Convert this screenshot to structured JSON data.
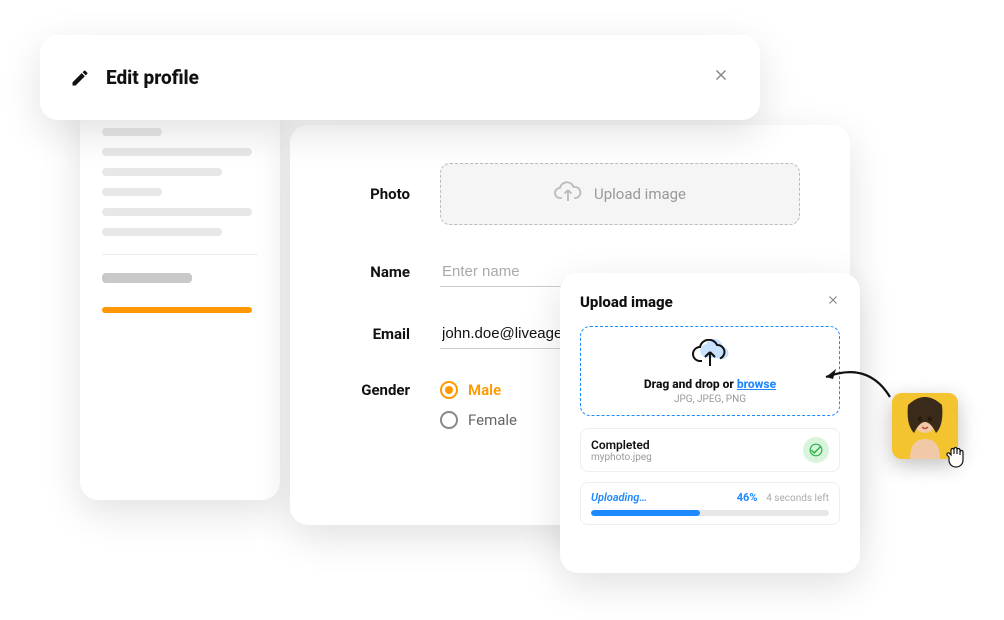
{
  "header": {
    "title": "Edit profile"
  },
  "form": {
    "photo_label": "Photo",
    "upload_zone_text": "Upload image",
    "name_label": "Name",
    "name_placeholder": "Enter name",
    "email_label": "Email",
    "email_value": "john.doe@liveagent.com",
    "gender_label": "Gender",
    "gender_options": {
      "male": "Male",
      "female": "Female"
    },
    "gender_selected": "male"
  },
  "upload_modal": {
    "title": "Upload image",
    "dropzone_prefix": "Drag and drop or ",
    "dropzone_link": "browse",
    "dropzone_formats": "JPG, JPEG, PNG",
    "completed": {
      "status": "Completed",
      "filename": "myphoto.jpeg"
    },
    "progress": {
      "status": "Uploading…",
      "percent": "46%",
      "percent_value": 46,
      "time_left": "4 seconds left"
    }
  }
}
